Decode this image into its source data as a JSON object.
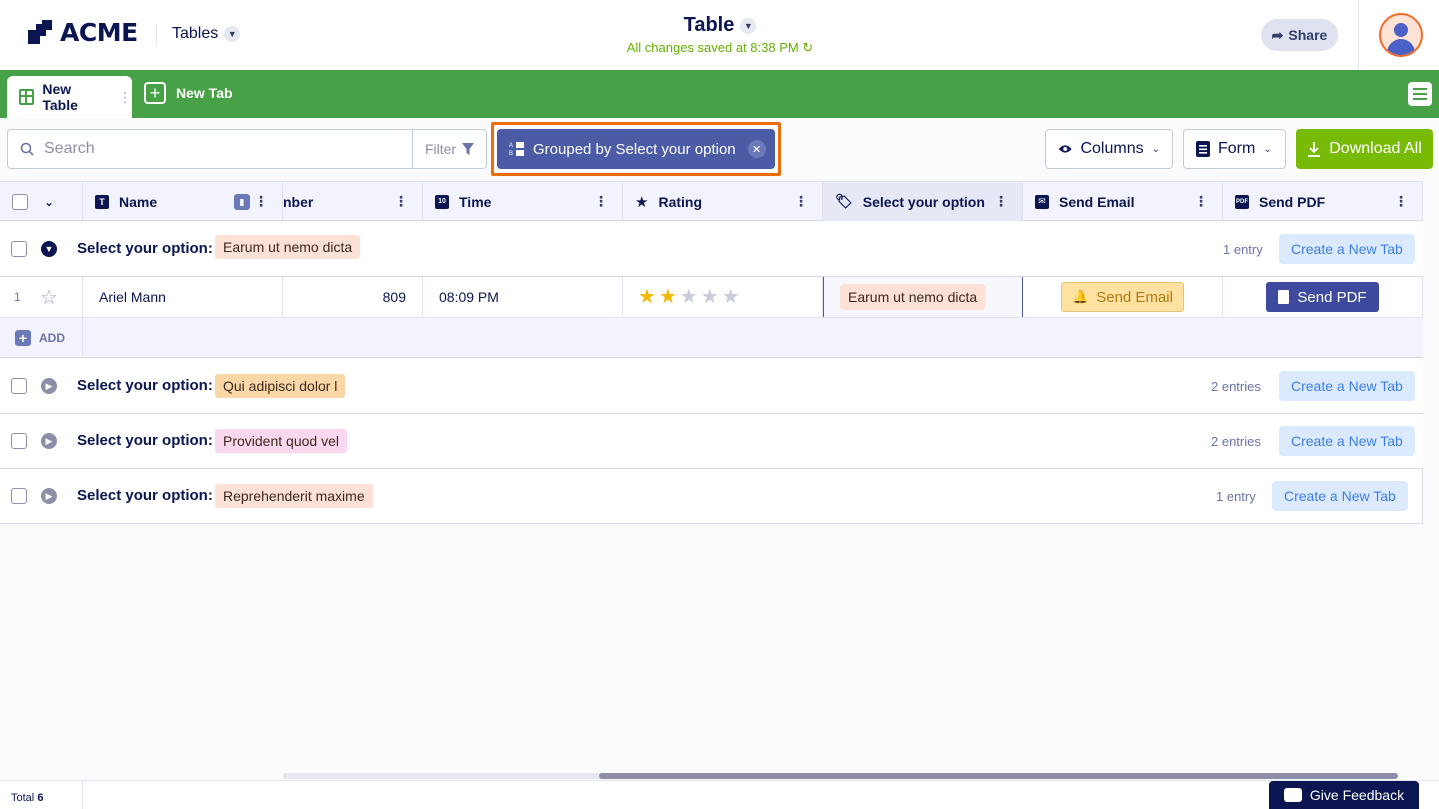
{
  "header": {
    "brand": "ACME",
    "tables_label": "Tables",
    "title": "Table",
    "saved_status": "All changes saved at 8:38 PM",
    "share_label": "Share"
  },
  "tabs": {
    "active_label": "New Table",
    "new_tab_label": "New Tab"
  },
  "toolbar": {
    "search_placeholder": "Search",
    "filter_label": "Filter",
    "group_chip_label": "Grouped by Select your option",
    "columns_label": "Columns",
    "form_label": "Form",
    "download_label": "Download All"
  },
  "columns": {
    "name": "Name",
    "number_partial": "nber",
    "time": "Time",
    "rating": "Rating",
    "select": "Select your option",
    "send_email": "Send Email",
    "send_pdf": "Send PDF"
  },
  "groups": [
    {
      "label": "Select your option:",
      "tag": "Earum ut nemo dicta",
      "tag_color": "#fde0d6",
      "count": "1 entry",
      "button": "Create a New Tab",
      "expanded": true
    },
    {
      "label": "Select your option:",
      "tag": "Qui adipisci dolor l",
      "tag_color": "#fbd7a8",
      "count": "2 entries",
      "button": "Create a New Tab",
      "expanded": false
    },
    {
      "label": "Select your option:",
      "tag": "Provident quod vel",
      "tag_color": "#f9d8ef",
      "count": "2 entries",
      "button": "Create a New Tab",
      "expanded": false
    },
    {
      "label": "Select your option:",
      "tag": "Reprehenderit maxime",
      "tag_color": "#fde0d6",
      "count": "1 entry",
      "button": "Create a New Tab",
      "expanded": false
    }
  ],
  "row": {
    "index": "1",
    "name": "Ariel Mann",
    "number": "809",
    "time": "08:09 PM",
    "rating": 2,
    "rating_max": 5,
    "select": "Earum ut nemo dicta",
    "send_email": "Send Email",
    "send_pdf": "Send PDF"
  },
  "add_label": "ADD",
  "footer": {
    "total_label": "Total",
    "total_count": "6",
    "feedback_label": "Give Feedback"
  },
  "colors": {
    "brand_green": "#47a147",
    "download_green": "#78bb07",
    "chip_indigo": "#4b5ba6",
    "highlight_orange": "#ec6d0c",
    "navy": "#0a1551"
  }
}
